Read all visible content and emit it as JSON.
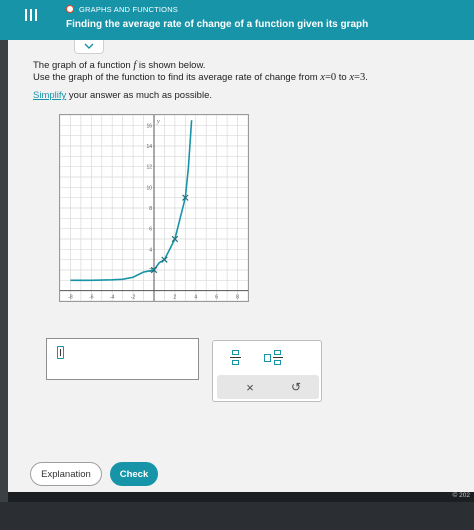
{
  "header": {
    "category": "GRAPHS AND FUNCTIONS",
    "title": "Finding the average rate of change of a function given its graph",
    "menu_icon": "hamburger-icon",
    "status_icon": "circle-progress-icon",
    "colors": {
      "brand": "#1794a8",
      "accent_circle": "#e64626"
    }
  },
  "problem": {
    "line1_prefix": "The graph of a function ",
    "line1_func": "f",
    "line1_suffix": " is shown below.",
    "line2_prefix": "Use the graph of the function to find its average rate of change from ",
    "x_var": "x",
    "eq": "=",
    "x_start": "0",
    "to": " to ",
    "x_end": "3",
    "period": ".",
    "simplify_link": "Simplify",
    "simplify_rest": " your answer as much as possible."
  },
  "graph": {
    "y_axis_label": "y",
    "x_ticks": [
      "-8",
      "-6",
      "-4",
      "-2",
      "2",
      "4",
      "6",
      "8"
    ],
    "y_ticks": [
      "2",
      "4",
      "6",
      "8",
      "10",
      "12",
      "14",
      "16"
    ]
  },
  "chart_data": {
    "type": "line",
    "x_range": [
      -9,
      9
    ],
    "y_range": [
      -1,
      17
    ],
    "grid": true,
    "curve_points": [
      {
        "x": -8,
        "y": 1.0
      },
      {
        "x": -6,
        "y": 1.0
      },
      {
        "x": -4,
        "y": 1.05
      },
      {
        "x": -3,
        "y": 1.1
      },
      {
        "x": -2,
        "y": 1.3
      },
      {
        "x": -1,
        "y": 1.8
      },
      {
        "x": 0,
        "y": 2
      },
      {
        "x": 0.5,
        "y": 2.7
      },
      {
        "x": 1,
        "y": 3
      },
      {
        "x": 1.5,
        "y": 4
      },
      {
        "x": 2,
        "y": 5
      },
      {
        "x": 2.5,
        "y": 7
      },
      {
        "x": 3,
        "y": 9
      },
      {
        "x": 3.3,
        "y": 12
      },
      {
        "x": 3.6,
        "y": 16.5
      }
    ],
    "marked_points": [
      {
        "x": 0,
        "y": 2
      },
      {
        "x": 1,
        "y": 3
      },
      {
        "x": 2,
        "y": 5
      },
      {
        "x": 3,
        "y": 9
      }
    ]
  },
  "answer": {
    "input_value": ""
  },
  "keypad": {
    "fraction_icon": "fraction-icon",
    "mixed_number_icon": "mixed-number-icon",
    "clear_label": "×",
    "undo_label": "↺"
  },
  "footer": {
    "explanation_label": "Explanation",
    "check_label": "Check",
    "copyright": "© 202"
  }
}
